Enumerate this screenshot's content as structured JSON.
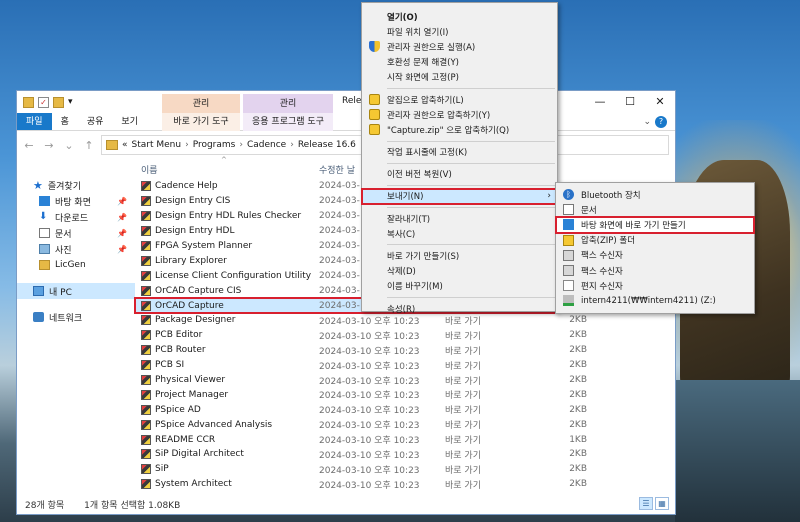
{
  "explorer": {
    "quick_access_down": "▾",
    "ctx_group_a": "관리",
    "ctx_group_b": "관리",
    "title_partial": "Release",
    "ribbon_tabs": {
      "file": "파일",
      "home": "홈",
      "share": "공유",
      "view": "보기",
      "shortcut_tools": "바로 가기 도구",
      "app_tools": "응용 프로그램 도구"
    },
    "address": [
      "Start Menu",
      "Programs",
      "Cadence",
      "Release 16.6"
    ],
    "address_prefix": "«",
    "nav": {
      "quick_access": "즐겨찾기",
      "items": [
        "바탕 화면",
        "다운로드",
        "문서",
        "사진",
        "LicGen"
      ],
      "this_pc": "내 PC",
      "network": "네트워크"
    },
    "columns": {
      "name": "이름",
      "date": "수정한 날",
      "type": "",
      "size": ""
    },
    "files": [
      {
        "name": "Cadence Help",
        "date": "2024-03-",
        "type": "",
        "size": ""
      },
      {
        "name": "Design Entry CIS",
        "date": "2024-03-",
        "type": "",
        "size": ""
      },
      {
        "name": "Design Entry HDL Rules Checker",
        "date": "2024-03-",
        "type": "",
        "size": ""
      },
      {
        "name": "Design Entry HDL",
        "date": "2024-03-",
        "type": "",
        "size": ""
      },
      {
        "name": "FPGA System Planner",
        "date": "2024-03-",
        "type": "",
        "size": ""
      },
      {
        "name": "Library Explorer",
        "date": "2024-03-",
        "type": "",
        "size": ""
      },
      {
        "name": "License Client Configuration Utility",
        "date": "2024-03-",
        "type": "",
        "size": ""
      },
      {
        "name": "OrCAD Capture CIS",
        "date": "2024-03-",
        "type": "",
        "size": ""
      },
      {
        "name": "OrCAD Capture",
        "date": "2024-03-",
        "type": "",
        "size": ""
      },
      {
        "name": "Package Designer",
        "date": "2024-03-10 오후 10:23",
        "type": "바로 가기",
        "size": "2KB"
      },
      {
        "name": "PCB Editor",
        "date": "2024-03-10 오후 10:23",
        "type": "바로 가기",
        "size": "2KB"
      },
      {
        "name": "PCB Router",
        "date": "2024-03-10 오후 10:23",
        "type": "바로 가기",
        "size": "2KB"
      },
      {
        "name": "PCB SI",
        "date": "2024-03-10 오후 10:23",
        "type": "바로 가기",
        "size": "2KB"
      },
      {
        "name": "Physical Viewer",
        "date": "2024-03-10 오후 10:23",
        "type": "바로 가기",
        "size": "2KB"
      },
      {
        "name": "Project Manager",
        "date": "2024-03-10 오후 10:23",
        "type": "바로 가기",
        "size": "2KB"
      },
      {
        "name": "PSpice AD",
        "date": "2024-03-10 오후 10:23",
        "type": "바로 가기",
        "size": "2KB"
      },
      {
        "name": "PSpice Advanced Analysis",
        "date": "2024-03-10 오후 10:23",
        "type": "바로 가기",
        "size": "2KB"
      },
      {
        "name": "README CCR",
        "date": "2024-03-10 오후 10:23",
        "type": "바로 가기",
        "size": "1KB"
      },
      {
        "name": "SiP Digital Architect",
        "date": "2024-03-10 오후 10:23",
        "type": "바로 가기",
        "size": "2KB"
      },
      {
        "name": "SiP",
        "date": "2024-03-10 오후 10:23",
        "type": "바로 가기",
        "size": "2KB"
      },
      {
        "name": "System Architect",
        "date": "2024-03-10 오후 10:23",
        "type": "바로 가기",
        "size": "2KB"
      }
    ],
    "selected_index": 8,
    "status": {
      "count": "28개 항목",
      "selection": "1개 항목 선택함 1.08KB"
    }
  },
  "context_menu": {
    "items": [
      {
        "label": "열기(O)",
        "icon": "",
        "bold": true
      },
      {
        "label": "파일 위치 열기(I)",
        "icon": ""
      },
      {
        "label": "관리자 권한으로 실행(A)",
        "icon": "shield-icon"
      },
      {
        "label": "호환성 문제 해결(Y)",
        "icon": ""
      },
      {
        "label": "시작 화면에 고정(P)",
        "icon": ""
      },
      {
        "sep": true
      },
      {
        "label": "알집으로 압축하기(L)",
        "icon": "alzip-icon"
      },
      {
        "label": "관리자 권한으로 압축하기(Y)",
        "icon": "alzip-admin-icon"
      },
      {
        "label": "\"Capture.zip\" 으로 압축하기(Q)",
        "icon": "alzip-icon"
      },
      {
        "sep": true
      },
      {
        "label": "작업 표시줄에 고정(K)",
        "icon": ""
      },
      {
        "sep": true
      },
      {
        "label": "이전 버전 복원(V)",
        "icon": ""
      },
      {
        "sep": true
      },
      {
        "label": "보내기(N)",
        "icon": "",
        "submenu": true,
        "highlight": true
      },
      {
        "sep": true
      },
      {
        "label": "잘라내기(T)",
        "icon": ""
      },
      {
        "label": "복사(C)",
        "icon": ""
      },
      {
        "sep": true
      },
      {
        "label": "바로 가기 만들기(S)",
        "icon": ""
      },
      {
        "label": "삭제(D)",
        "icon": ""
      },
      {
        "label": "이름 바꾸기(M)",
        "icon": ""
      },
      {
        "sep": true
      },
      {
        "label": "속성(R)",
        "icon": ""
      }
    ]
  },
  "send_to": {
    "items": [
      {
        "label": "Bluetooth 장치",
        "icon": "bluetooth-icon"
      },
      {
        "label": "문서",
        "icon": "document-icon"
      },
      {
        "label": "바탕 화면에 바로 가기 만들기",
        "icon": "desktop-icon",
        "highlight": true
      },
      {
        "label": "압축(ZIP) 폴더",
        "icon": "zip-folder-icon"
      },
      {
        "label": "팩스 수신자",
        "icon": "fax-icon"
      },
      {
        "label": "팩스 수신자",
        "icon": "fax-icon"
      },
      {
        "label": "편지 수신자",
        "icon": "mail-icon"
      },
      {
        "label": "intern4211(₩₩intern4211) (Z:)",
        "icon": "network-drive-icon"
      }
    ]
  }
}
